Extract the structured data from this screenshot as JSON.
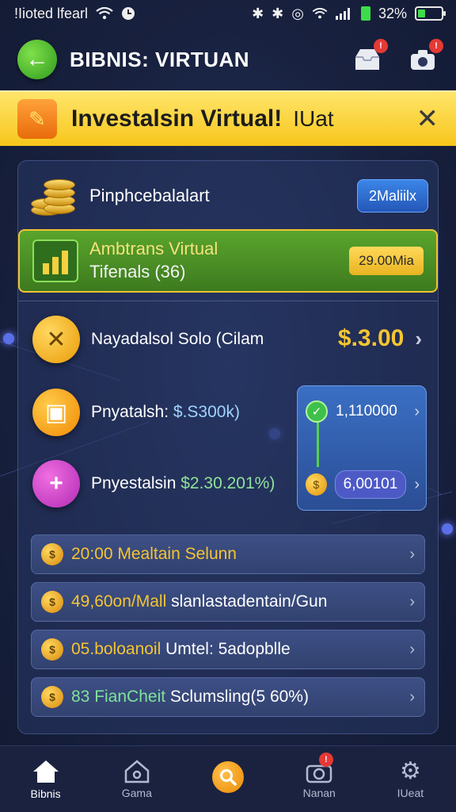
{
  "status_bar": {
    "carrier": "!Iioted lfearl",
    "battery": "32%",
    "battery_level": 0.32
  },
  "header": {
    "title": "BIBNIS: VIRTUAN",
    "badge_1": "!",
    "badge_2": "!"
  },
  "banner": {
    "text": "Investalsin Virtual!",
    "suffix": "IUat"
  },
  "balance": {
    "label": "Pinphcebalalart",
    "button": "2Maliilx"
  },
  "promo": {
    "title": "Ambtrans Virtual",
    "subtitle": "Tifenals (36)",
    "pill": "29.00Mia"
  },
  "investments": [
    {
      "label": "Nayadalsol Solo (Cilam",
      "amount": "$.3.00"
    },
    {
      "label_prefix": "Pnyatalsh: ",
      "label_value": "$.S300k)"
    },
    {
      "label_prefix": "Pnyestalsin ",
      "label_value": "$2.30.201%)"
    }
  ],
  "side_card": {
    "top_value": "1,110000",
    "bottom_value": "6,00101"
  },
  "list": [
    {
      "text": "20:00 Mealtain Selunn",
      "color": "#f5c531"
    },
    {
      "text_prefix": "49,60on/Mall",
      "text_rest": " slanlastadentain/Gun",
      "color": "#f5c531"
    },
    {
      "text_prefix": "05.boloanoil",
      "text_rest": " Umtel: 5adopblle",
      "color": "#f5c531"
    },
    {
      "text_prefix": "83 FianCheit",
      "text_rest": " Sclumsling(5 60%)",
      "color": "#7fe39a"
    }
  ],
  "bottom_nav": [
    {
      "label": "Bibnis",
      "icon": "home-icon"
    },
    {
      "label": "Gama",
      "icon": "game-icon"
    },
    {
      "label": "",
      "icon": "search-icon"
    },
    {
      "label": "Nanan",
      "icon": "camera-icon",
      "badge": "!"
    },
    {
      "label": "IUeat",
      "icon": "gear-icon"
    }
  ]
}
